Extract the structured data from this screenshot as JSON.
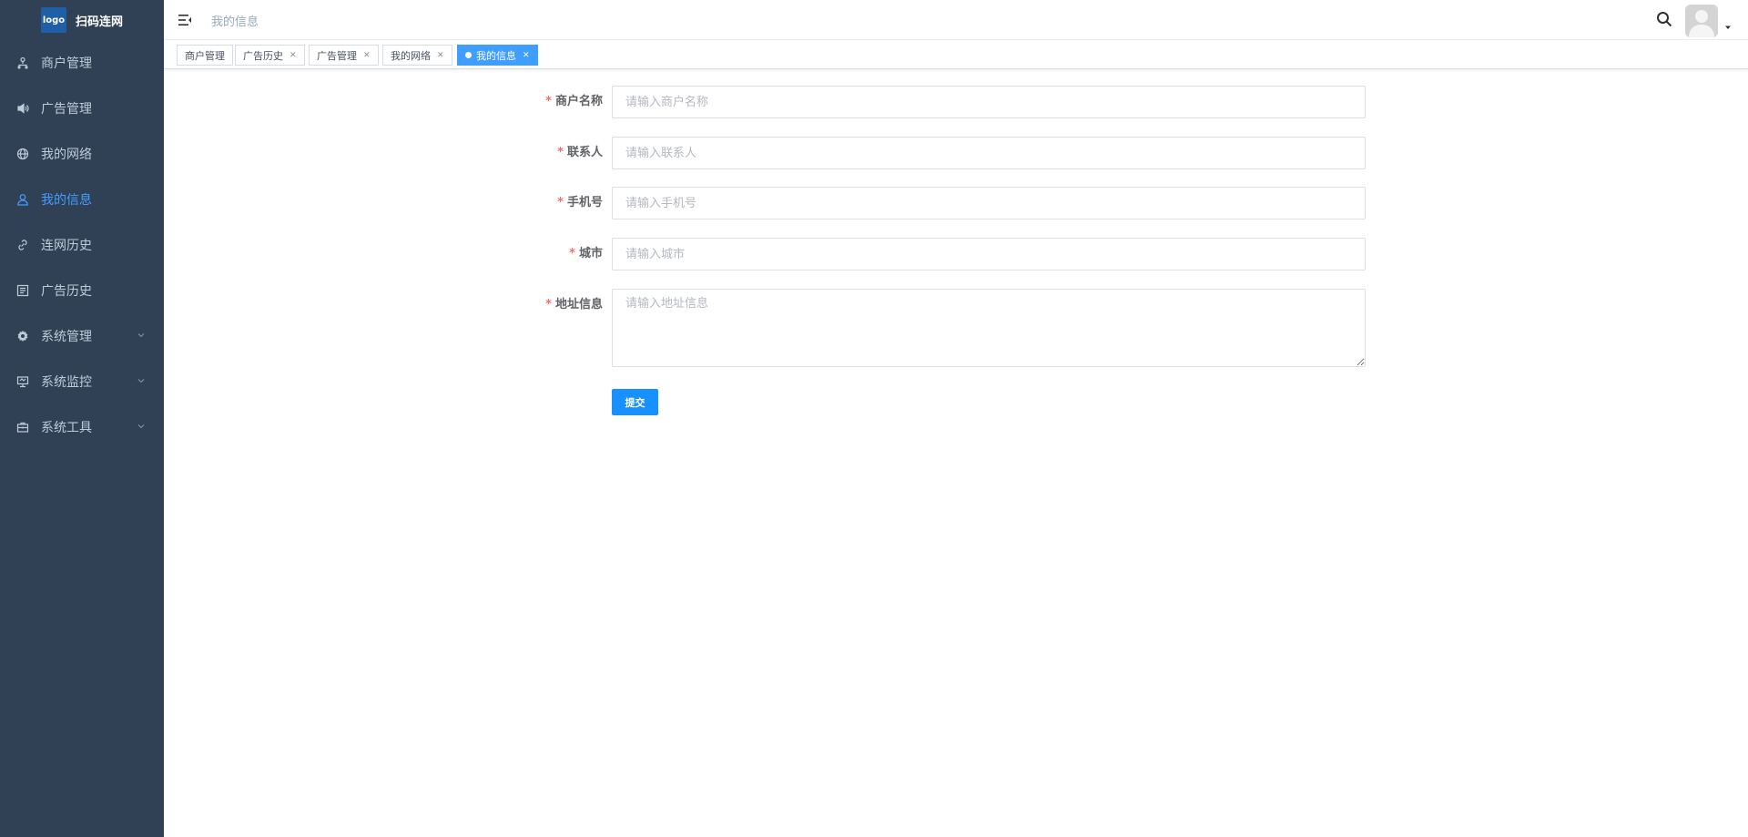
{
  "brand": {
    "logo_text": "logo",
    "title": "扫码连网"
  },
  "sidebar": {
    "items": [
      {
        "label": "商户管理",
        "icon": "merchant-icon",
        "active": false,
        "has_children": false
      },
      {
        "label": "广告管理",
        "icon": "speaker-icon",
        "active": false,
        "has_children": false
      },
      {
        "label": "我的网络",
        "icon": "globe-icon",
        "active": false,
        "has_children": false
      },
      {
        "label": "我的信息",
        "icon": "user-icon",
        "active": true,
        "has_children": false
      },
      {
        "label": "连网历史",
        "icon": "link-icon",
        "active": false,
        "has_children": false
      },
      {
        "label": "广告历史",
        "icon": "billboard-icon",
        "active": false,
        "has_children": false
      },
      {
        "label": "系统管理",
        "icon": "gear-icon",
        "active": false,
        "has_children": true
      },
      {
        "label": "系统监控",
        "icon": "monitor-icon",
        "active": false,
        "has_children": true
      },
      {
        "label": "系统工具",
        "icon": "toolbox-icon",
        "active": false,
        "has_children": true
      }
    ]
  },
  "header": {
    "breadcrumb": "我的信息"
  },
  "tags": [
    {
      "label": "商户管理",
      "closable": false,
      "active": false
    },
    {
      "label": "广告历史",
      "closable": true,
      "active": false
    },
    {
      "label": "广告管理",
      "closable": true,
      "active": false
    },
    {
      "label": "我的网络",
      "closable": true,
      "active": false
    },
    {
      "label": "我的信息",
      "closable": true,
      "active": true
    }
  ],
  "form": {
    "merchant_name": {
      "label": "商户名称",
      "placeholder": "请输入商户名称",
      "value": ""
    },
    "contact": {
      "label": "联系人",
      "placeholder": "请输入联系人",
      "value": ""
    },
    "phone": {
      "label": "手机号",
      "placeholder": "请输入手机号",
      "value": ""
    },
    "city": {
      "label": "城市",
      "placeholder": "请输入城市",
      "value": ""
    },
    "address": {
      "label": "地址信息",
      "placeholder": "请输入地址信息",
      "value": ""
    },
    "required_mark": "*",
    "submit_label": "提交"
  },
  "colors": {
    "sidebar_bg": "#304156",
    "accent": "#409eff",
    "button": "#1890ff",
    "required": "#f56c6c"
  }
}
